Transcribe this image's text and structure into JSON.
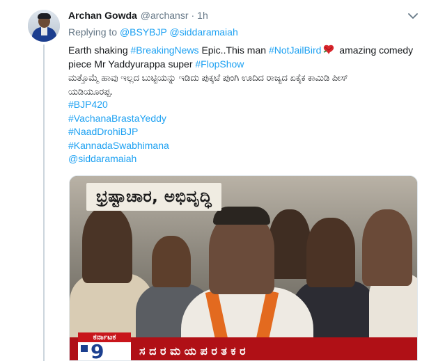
{
  "author": {
    "name": "Archan Gowda",
    "handle": "@archansr",
    "separator": "·",
    "time": "1h"
  },
  "replying": {
    "prefix": "Replying to",
    "mentions": [
      "@BSYBJP",
      "@siddaramaiah"
    ]
  },
  "tweet": {
    "line1_a": "Earth shaking ",
    "tag_breaking": "#BreakingNews",
    "line1_b": " Epic..This man ",
    "tag_notjail": "#NotJailBird",
    "line1_c": " amazing comedy",
    "line2_a": "piece Mr Yaddyurappa super ",
    "tag_flop": "#FlopShow",
    "kannada_line1": "ಮತ್ತೊಮ್ಮೆ ಹಾವು ಇಲ್ಲದ ಬುಟ್ಟಿಯನ್ನು ಇಡಿದು ಪುಕ್ಕಟೆ ಪುಂಗಿ ಊದಿದ ರಾಜ್ಯದ ಏಕೈಕ ಕಾಮಿಡಿ ಪೀಸ್",
    "kannada_line2": "ಯಡಿಯೂರಪ್ಪ.",
    "hashtags": [
      "#BJP420",
      "#VachanaBrastaYeddy",
      "#NaadDrohiBJP",
      "#KannadaSwabhimana"
    ],
    "mention_end": "@siddaramaiah"
  },
  "media": {
    "banner_text": "ಭ್ರಷ್ಟಾಚಾರ, ಅಭಿವೃದ್ಧಿ",
    "logo_top": "ಕರ್ನಾಟಕ",
    "logo_number": "9",
    "ticker": "ಸ ದ ರ ಮ ಯ ಪ ರ ತ ಕ ರ"
  },
  "icons": {
    "caret": "chevron-down-icon",
    "rose": "rose-emoji-icon"
  },
  "colors": {
    "link": "#1da1f2",
    "secondary": "#657786",
    "text": "#14171a"
  }
}
